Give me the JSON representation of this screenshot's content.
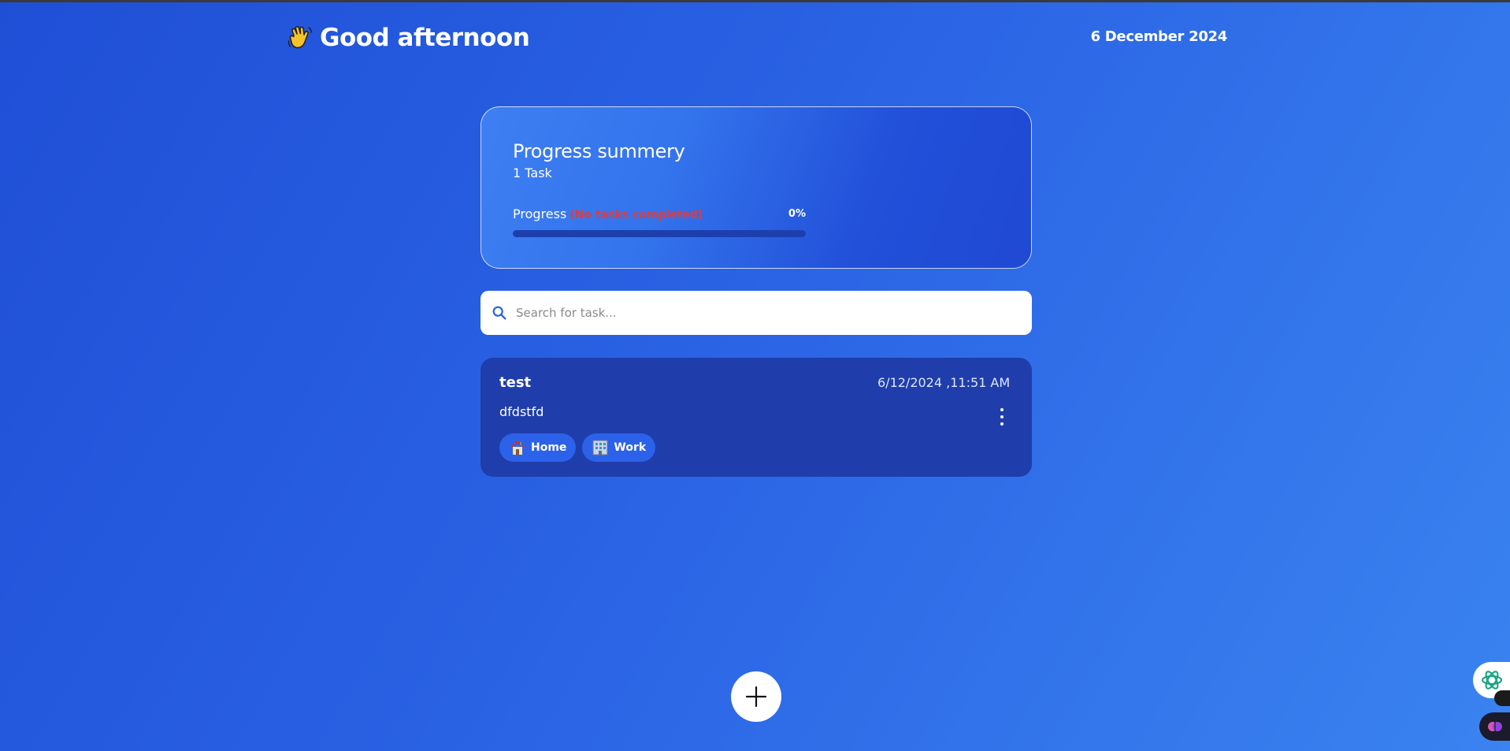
{
  "header": {
    "greeting": "Good afternoon",
    "date": "6 December 2024"
  },
  "progress": {
    "title": "Progress summery",
    "task_count": "1 Task",
    "label": "Progress",
    "status": "(No tasks completed)",
    "percent_text": "0%",
    "percent_value": 0
  },
  "search": {
    "placeholder": "Search for task..."
  },
  "tasks": [
    {
      "title": "test",
      "datetime": "6/12/2024 ,11:51 AM",
      "description": "dfdstfd",
      "tags": [
        {
          "label": "Home",
          "icon": "house-icon"
        },
        {
          "label": "Work",
          "icon": "office-building-icon"
        }
      ]
    }
  ],
  "colors": {
    "background_start": "#1f4fd6",
    "background_end": "#3a83f0",
    "card": "#1f3eab",
    "tag": "#2c62ea",
    "status_red": "#e23b3b"
  },
  "icons": {
    "greeting": "waving-hand-icon",
    "search": "search-icon",
    "menu": "more-vertical-icon",
    "add": "plus-icon"
  }
}
